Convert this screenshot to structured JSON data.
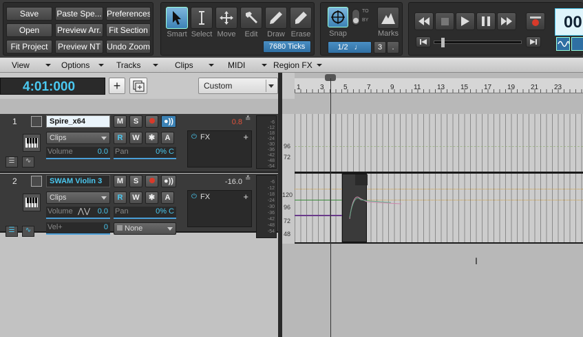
{
  "toolbar": {
    "buttons": [
      "Save",
      "Paste Spe...",
      "Preferences",
      "Open",
      "Preview Arr.",
      "Fit Section",
      "Fit Project",
      "Preview NT",
      "Undo Zoom"
    ],
    "tools": [
      {
        "label": "Smart",
        "icon": "arrow-cursor-icon"
      },
      {
        "label": "Select",
        "icon": "i-beam-icon"
      },
      {
        "label": "Move",
        "icon": "move-arrows-icon"
      },
      {
        "label": "Edit",
        "icon": "hammer-icon"
      },
      {
        "label": "Draw",
        "icon": "pencil-icon"
      },
      {
        "label": "Erase",
        "icon": "eraser-icon"
      }
    ],
    "ticks": "7680 Ticks",
    "snap_label": "Snap",
    "snap_to": "TO",
    "snap_by": "BY",
    "snap_value": "1/2",
    "snap_num": "3",
    "snap_dot": ".",
    "marks_label": "Marks",
    "time_display": "00"
  },
  "menus": [
    "View",
    "Options",
    "Tracks",
    "Clips",
    "MIDI",
    "Region FX"
  ],
  "control": {
    "now_time": "4:01:000",
    "custom": "Custom"
  },
  "ruler": [
    "1",
    "3",
    "5",
    "7",
    "9",
    "11",
    "13",
    "15",
    "17",
    "19",
    "21",
    "23"
  ],
  "tracks": [
    {
      "num": "1",
      "name": "Spire_x64",
      "clips": "Clips",
      "volume_label": "Volume",
      "volume_value": "0.0",
      "pan_label": "Pan",
      "pan_value": "0% C",
      "level": "0.8",
      "fx": "FX",
      "meter": [
        "-6",
        "-12",
        "-18",
        "-24",
        "-30",
        "-36",
        "-42",
        "-48",
        "-54"
      ],
      "lane_labels": [
        "96",
        "72"
      ]
    },
    {
      "num": "2",
      "name": "SWAM Violin 3",
      "clips": "Clips",
      "volume_label": "Volume",
      "volume_value": "0.0",
      "pan_label": "Pan",
      "pan_value": "0% C",
      "vel_label": "Vel+",
      "vel_value": "0",
      "none": "None",
      "level": "-16.0",
      "fx": "FX",
      "meter": [
        "-6",
        "-12",
        "-18",
        "-24",
        "-30",
        "-36",
        "-42",
        "-48",
        "-54"
      ],
      "lane_labels": [
        "120",
        "96",
        "72",
        "48"
      ]
    }
  ],
  "colors": {
    "accent": "#4ac8f0",
    "record": "#d83a2a",
    "level1": "#e0523a"
  }
}
